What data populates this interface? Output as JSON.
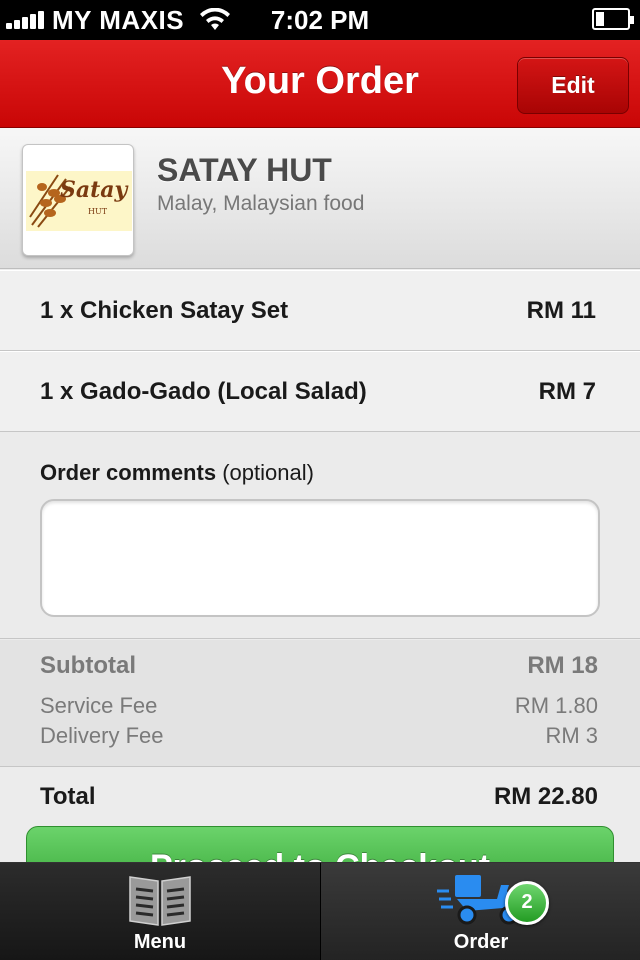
{
  "status_bar": {
    "carrier": "MY MAXIS",
    "time": "7:02 PM"
  },
  "nav": {
    "title": "Your Order",
    "edit_label": "Edit"
  },
  "restaurant": {
    "logo_text": "Satay",
    "logo_sub": "HUT",
    "name": "SATAY HUT",
    "cuisine": "Malay, Malaysian food"
  },
  "order_items": [
    {
      "name": "1 x Chicken Satay Set",
      "price": "RM 11"
    },
    {
      "name": "1 x Gado-Gado (Local Salad)",
      "price": "RM 7"
    }
  ],
  "comments": {
    "label": "Order comments",
    "label_suffix": "(optional)",
    "value": ""
  },
  "totals": {
    "subtotal_label": "Subtotal",
    "subtotal_value": "RM 18",
    "service_fee_label": "Service Fee",
    "service_fee_value": "RM 1.80",
    "delivery_fee_label": "Delivery Fee",
    "delivery_fee_value": "RM 3",
    "total_label": "Total",
    "total_value": "RM 22.80"
  },
  "checkout": {
    "label": "Proceed to Checkout"
  },
  "tabs": {
    "menu_label": "Menu",
    "order_label": "Order",
    "order_badge": "2",
    "menu_icon": "menu-book-icon",
    "order_icon": "delivery-scooter-icon"
  },
  "colors": {
    "nav_red": "#d91414",
    "checkout_green": "#4fc24f",
    "scooter_blue": "#2a8cf0"
  }
}
